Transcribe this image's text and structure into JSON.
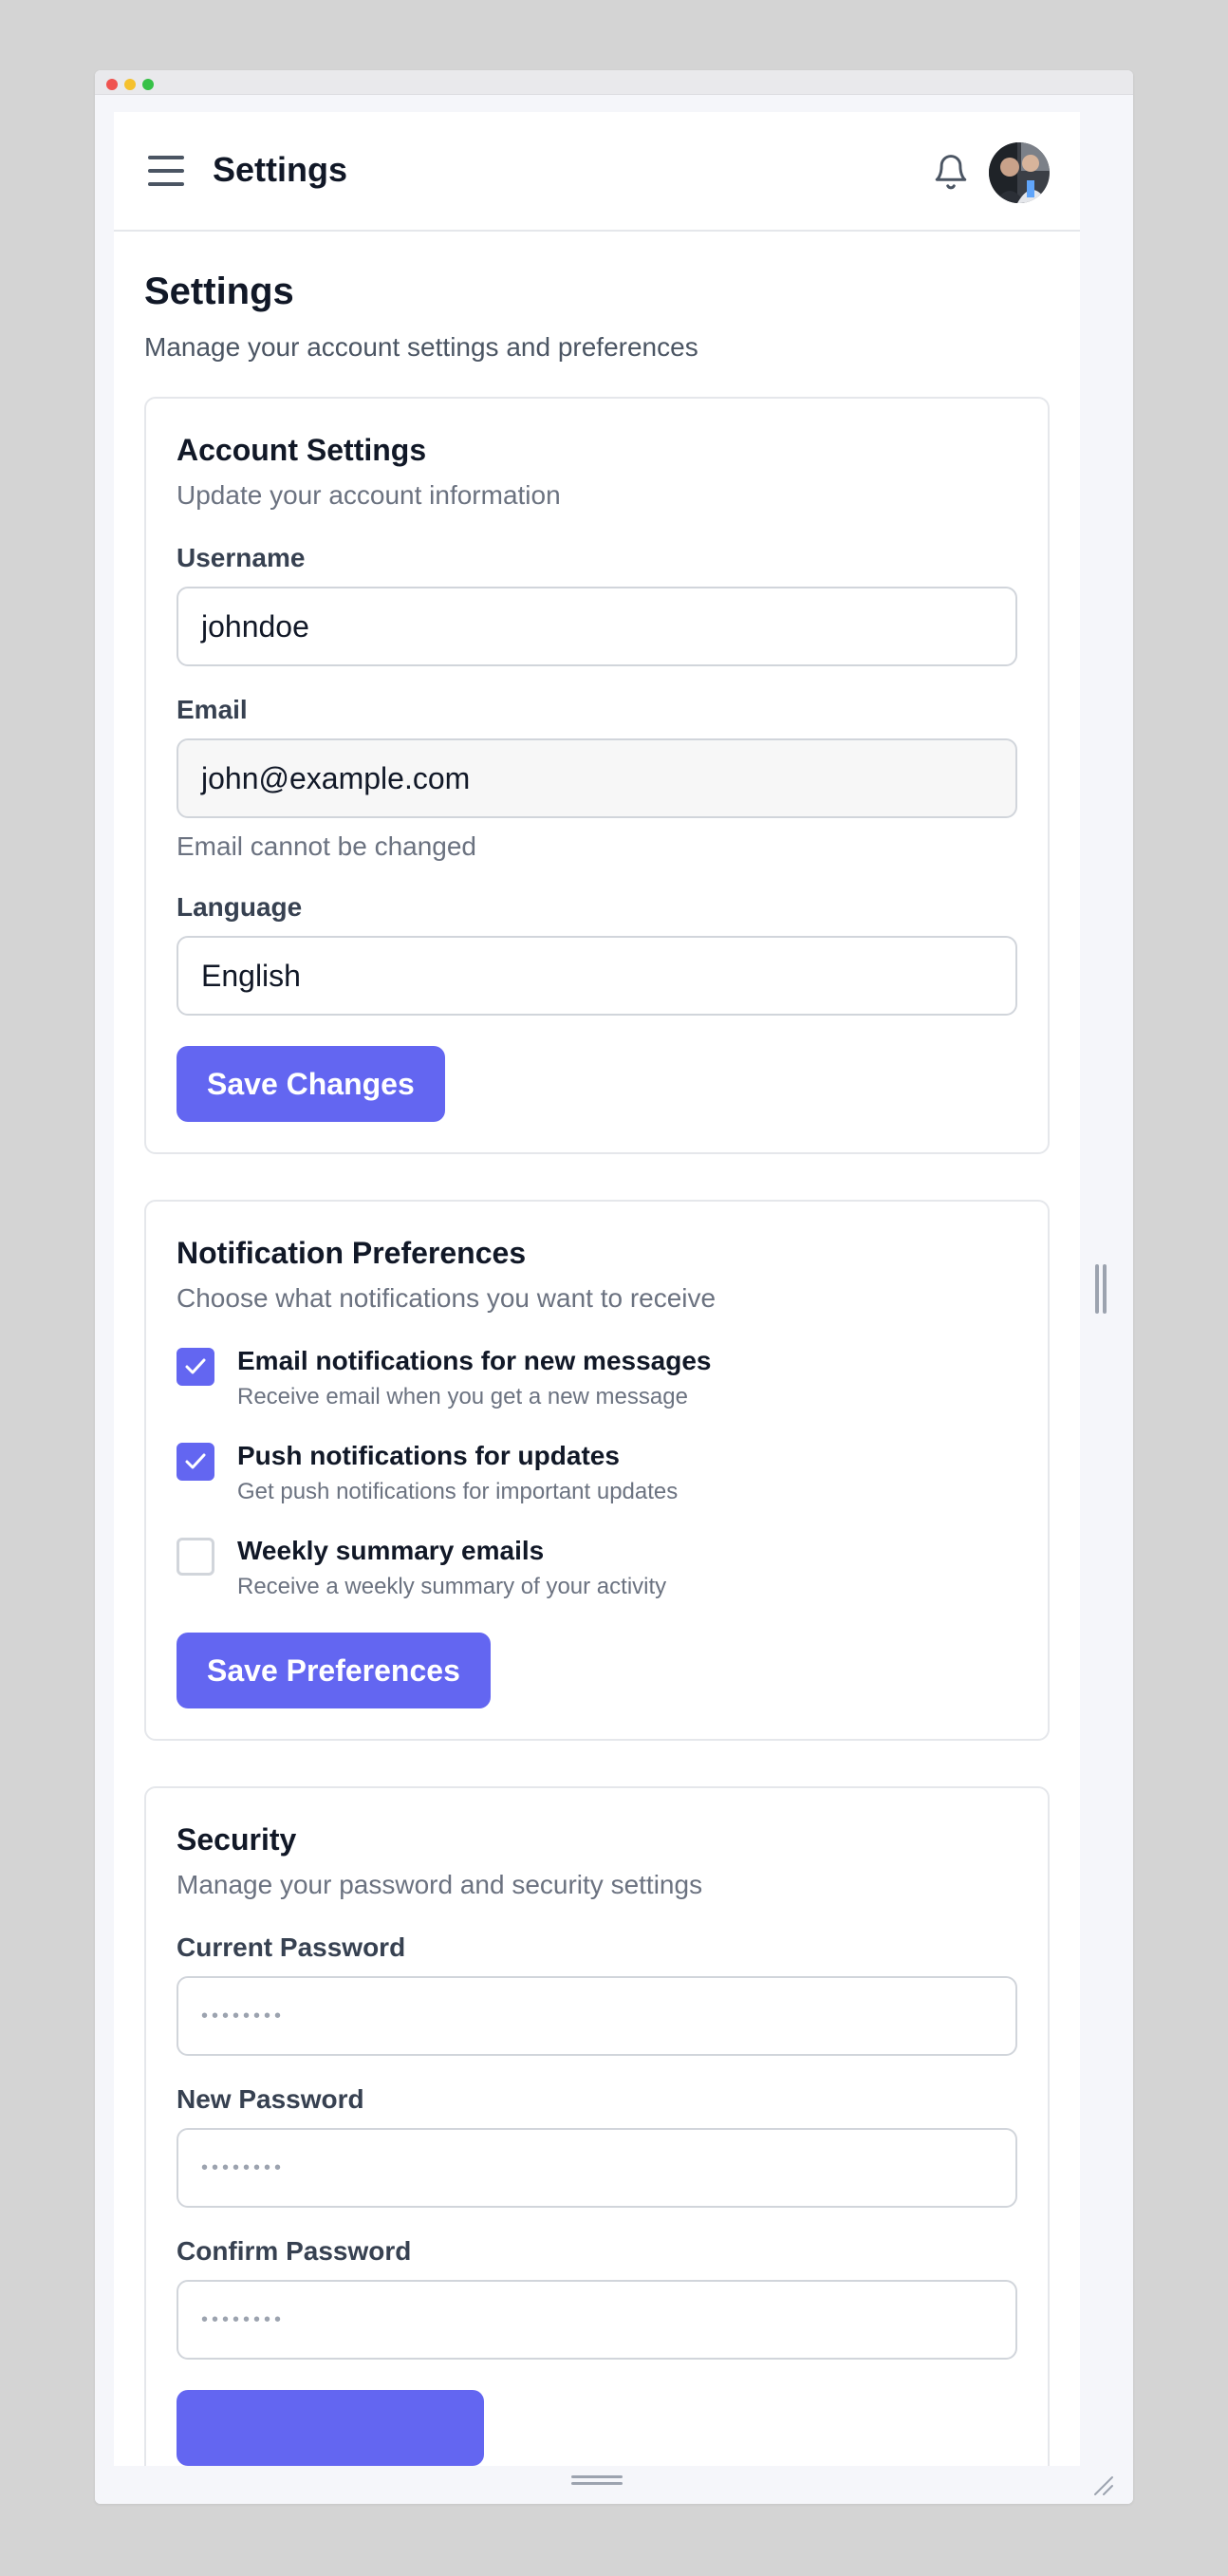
{
  "topbar": {
    "title": "Settings",
    "menu_icon": "hamburger-menu-icon",
    "notification_icon": "bell-icon",
    "avatar_icon": "user-avatar"
  },
  "page": {
    "title": "Settings",
    "subtitle": "Manage your account settings and preferences"
  },
  "account": {
    "title": "Account Settings",
    "description": "Update your account information",
    "username_label": "Username",
    "username_value": "johndoe",
    "email_label": "Email",
    "email_value": "john@example.com",
    "email_help": "Email cannot be changed",
    "language_label": "Language",
    "language_value": "English",
    "save_label": "Save Changes"
  },
  "notifications": {
    "title": "Notification Preferences",
    "description": "Choose what notifications you want to receive",
    "items": [
      {
        "label": "Email notifications for new messages",
        "description": "Receive email when you get a new message",
        "checked": true
      },
      {
        "label": "Push notifications for updates",
        "description": "Get push notifications for important updates",
        "checked": true
      },
      {
        "label": "Weekly summary emails",
        "description": "Receive a weekly summary of your activity",
        "checked": false
      }
    ],
    "save_label": "Save Preferences"
  },
  "security": {
    "title": "Security",
    "description": "Manage your password and security settings",
    "current_label": "Current Password",
    "new_label": "New Password",
    "confirm_label": "Confirm Password",
    "password_mask": "••••••••"
  },
  "colors": {
    "accent": "#6366f1",
    "background": "#d4d4d4",
    "text_primary": "#111827",
    "text_secondary": "#6b7280"
  }
}
